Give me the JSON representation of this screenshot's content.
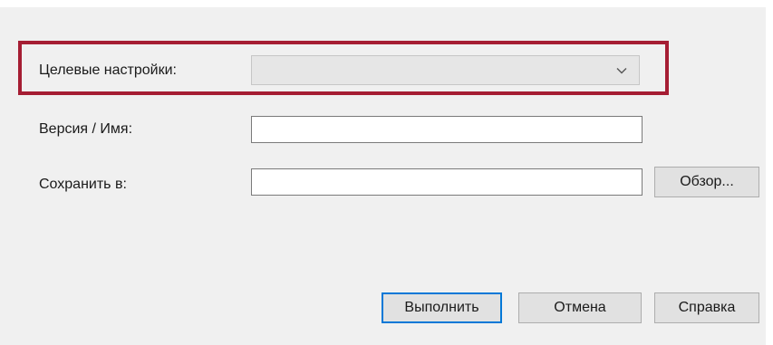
{
  "form": {
    "target_settings": {
      "label": "Целевые настройки:",
      "value": ""
    },
    "version_name": {
      "label": "Версия / Имя:",
      "value": ""
    },
    "save_to": {
      "label": "Сохранить в:",
      "value": "",
      "browse_label": "Обзор..."
    }
  },
  "buttons": {
    "execute": "Выполнить",
    "cancel": "Отмена",
    "help": "Справка"
  },
  "colors": {
    "highlight_border": "#a51d33",
    "default_button_border": "#0078d7"
  },
  "icons": {
    "dropdown": "chevron-down-icon"
  }
}
